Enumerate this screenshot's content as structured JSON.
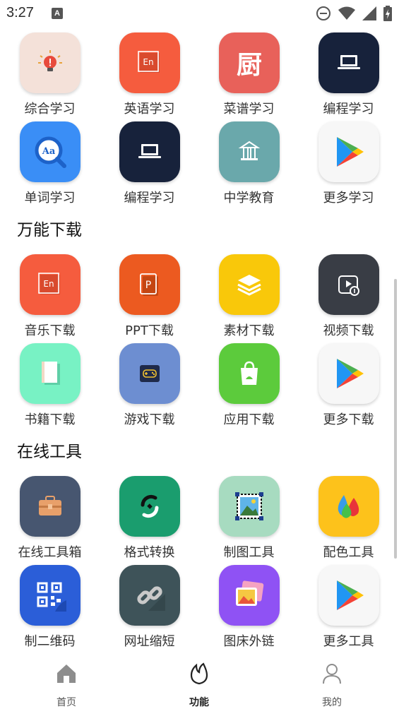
{
  "status": {
    "time": "3:27",
    "notification_badge": "A"
  },
  "grid_learn": [
    {
      "label": "综合学习",
      "icon": "lightbulb-icon",
      "bg": "#f4e1d9"
    },
    {
      "label": "英语学习",
      "icon": "english-doc-icon",
      "bg": "#f55c3e"
    },
    {
      "label": "菜谱学习",
      "icon": "kitchen-icon",
      "bg": "#e8615a",
      "glyph": "厨"
    },
    {
      "label": "编程学习",
      "icon": "laptop-icon",
      "bg": "#17223b"
    },
    {
      "label": "单词学习",
      "icon": "dictionary-search-icon",
      "bg": "#3a8ef6",
      "glyph": "Aa"
    },
    {
      "label": "编程学习",
      "icon": "laptop-icon",
      "bg": "#17223b"
    },
    {
      "label": "中学教育",
      "icon": "school-icon",
      "bg": "#6aa8ab"
    },
    {
      "label": "更多学习",
      "icon": "play-store-icon",
      "bg": "#f7f7f7"
    }
  ],
  "section_download": {
    "title": "万能下载"
  },
  "grid_download": [
    {
      "label": "音乐下载",
      "icon": "english-doc-icon",
      "bg": "#f55c3e"
    },
    {
      "label": "PPT下载",
      "icon": "ppt-icon",
      "bg": "#ec5a20"
    },
    {
      "label": "素材下载",
      "icon": "layers-icon",
      "bg": "#f9c80a"
    },
    {
      "label": "视频下载",
      "icon": "video-download-icon",
      "bg": "#393d45"
    },
    {
      "label": "书籍下载",
      "icon": "book-icon",
      "bg": "#78f2c4"
    },
    {
      "label": "游戏下载",
      "icon": "gamepad-icon",
      "bg": "#6d8ed1"
    },
    {
      "label": "应用下载",
      "icon": "app-bag-icon",
      "bg": "#5ccb3c"
    },
    {
      "label": "更多下载",
      "icon": "play-store-icon",
      "bg": "#f7f7f7"
    }
  ],
  "section_tools": {
    "title": "在线工具"
  },
  "grid_tools": [
    {
      "label": "在线工具箱",
      "icon": "toolbox-icon",
      "bg": "#475670"
    },
    {
      "label": "格式转换",
      "icon": "convert-icon",
      "bg": "#1a9d6e"
    },
    {
      "label": "制图工具",
      "icon": "image-frame-icon",
      "bg": "#a7dbc0"
    },
    {
      "label": "配色工具",
      "icon": "color-drops-icon",
      "bg": "#fdc21b"
    },
    {
      "label": "制二维码",
      "icon": "qr-code-icon",
      "bg": "#2b5ed8"
    },
    {
      "label": "网址缩短",
      "icon": "link-icon",
      "bg": "#3e5359"
    },
    {
      "label": "图床外链",
      "icon": "gallery-icon",
      "bg": "#8f52f4"
    },
    {
      "label": "更多工具",
      "icon": "play-store-icon",
      "bg": "#f7f7f7"
    }
  ],
  "bottom_nav": [
    {
      "label": "首页",
      "icon": "home-icon"
    },
    {
      "label": "功能",
      "icon": "flame-icon",
      "active": true
    },
    {
      "label": "我的",
      "icon": "user-icon"
    }
  ]
}
